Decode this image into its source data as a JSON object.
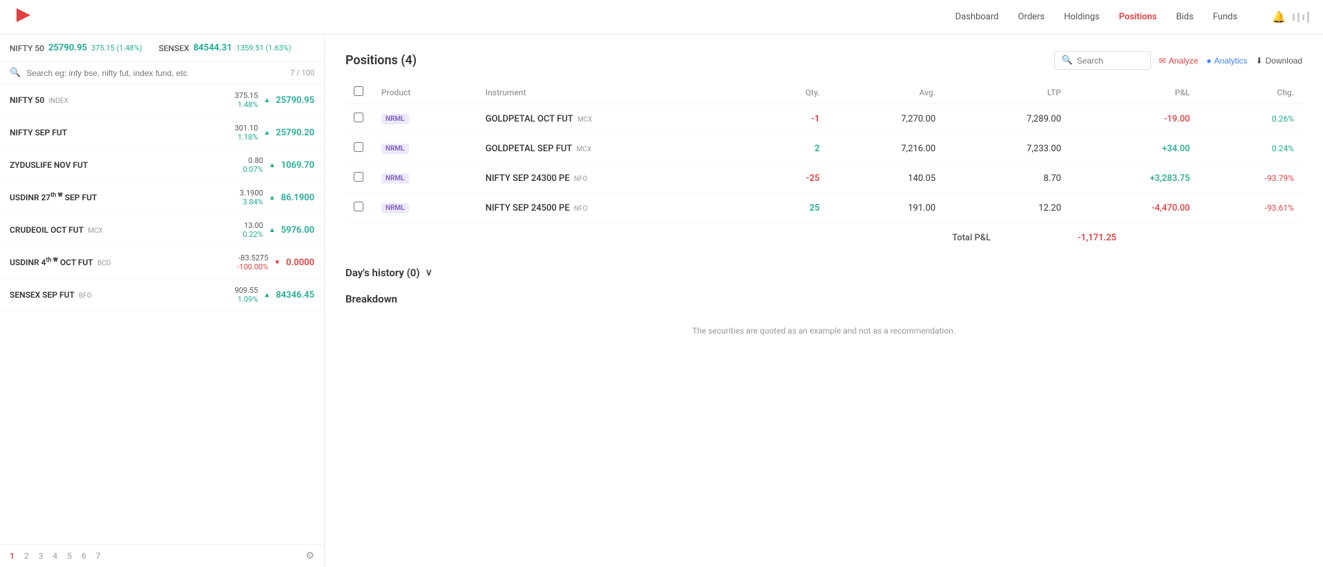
{
  "topnav": {
    "logo": "🔴",
    "links": [
      {
        "label": "Dashboard",
        "active": false
      },
      {
        "label": "Orders",
        "active": false
      },
      {
        "label": "Holdings",
        "active": false
      },
      {
        "label": "Positions",
        "active": true
      },
      {
        "label": "Bids",
        "active": false
      },
      {
        "label": "Funds",
        "active": false
      }
    ]
  },
  "market": [
    {
      "name": "NIFTY 50",
      "value": "25790.95",
      "change": "375.15 (1.48%)",
      "direction": "up"
    },
    {
      "name": "SENSEX",
      "value": "84544.31",
      "change": "1359.51 (1.63%)",
      "direction": "up"
    }
  ],
  "search": {
    "placeholder": "Search eg: infy bse, nifty fut, index fund, etc",
    "count": "7 / 100"
  },
  "watchlist": [
    {
      "name": "NIFTY 50",
      "exchange": "INDEX",
      "change": "375.15",
      "changePct": "1.48%",
      "ltp": "25790.95",
      "direction": "up",
      "sup": ""
    },
    {
      "name": "NIFTY SEP FUT",
      "exchange": "",
      "change": "301.10",
      "changePct": "1.18%",
      "ltp": "25790.20",
      "direction": "up",
      "sup": ""
    },
    {
      "name": "ZYDUSLIFE NOV FUT",
      "exchange": "",
      "change": "0.80",
      "changePct": "0.07%",
      "ltp": "1069.70",
      "direction": "up",
      "sup": ""
    },
    {
      "name": "USDINR 27",
      "exchange": "SEP FUT",
      "change": "3.1900",
      "changePct": "3.84%",
      "ltp": "86.1900",
      "direction": "up",
      "sup": "th ₩"
    },
    {
      "name": "CRUDEOIL OCT FUT",
      "exchange": "MCX",
      "change": "13.00",
      "changePct": "0.22%",
      "ltp": "5976.00",
      "direction": "up",
      "sup": ""
    },
    {
      "name": "USDINR 4",
      "exchange": "OCT FUT",
      "exchange2": "BCD",
      "change": "-83.5275",
      "changePct": "-100.00%",
      "ltp": "0.0000",
      "direction": "down",
      "sup": "th ₩"
    },
    {
      "name": "SENSEX SEP FUT",
      "exchange": "BFO",
      "change": "909.55",
      "changePct": "1.09%",
      "ltp": "84346.45",
      "direction": "up",
      "sup": ""
    }
  ],
  "pagination": {
    "pages": [
      "1",
      "2",
      "3",
      "4",
      "5",
      "6",
      "7"
    ],
    "active": "1"
  },
  "positions": {
    "title": "Positions",
    "count": 4,
    "columns": [
      "Product",
      "Instrument",
      "Qty.",
      "Avg.",
      "LTP",
      "P&L",
      "Chg."
    ],
    "rows": [
      {
        "product": "NRML",
        "instrument": "GOLDPETAL OCT FUT",
        "exchange": "MCX",
        "qty": "-1",
        "avg": "7,270.00",
        "ltp": "7,289.00",
        "pnl": "-19.00",
        "chg": "0.26%",
        "qtyType": "neg",
        "pnlType": "neg"
      },
      {
        "product": "NRML",
        "instrument": "GOLDPETAL SEP FUT",
        "exchange": "MCX",
        "qty": "2",
        "avg": "7,216.00",
        "ltp": "7,233.00",
        "pnl": "+34.00",
        "chg": "0.24%",
        "qtyType": "pos",
        "pnlType": "pos"
      },
      {
        "product": "NRML",
        "instrument": "NIFTY SEP 24300 PE",
        "exchange": "NFO",
        "qty": "-25",
        "avg": "140.05",
        "ltp": "8.70",
        "pnl": "+3,283.75",
        "chg": "-93.79%",
        "qtyType": "neg",
        "pnlType": "pos"
      },
      {
        "product": "NRML",
        "instrument": "NIFTY SEP 24500 PE",
        "exchange": "NFO",
        "qty": "25",
        "avg": "191.00",
        "ltp": "12.20",
        "pnl": "-4,470.00",
        "chg": "-93.61%",
        "qtyType": "pos",
        "pnlType": "neg"
      }
    ],
    "totalLabel": "Total P&L",
    "totalValue": "-1,171.25"
  },
  "actions": {
    "searchPlaceholder": "Search",
    "analyzeLabel": "Analyze",
    "analyticsLabel": "Analytics",
    "downloadLabel": "Download"
  },
  "daysHistory": {
    "title": "Day's history",
    "count": 0
  },
  "breakdown": {
    "title": "Breakdown"
  },
  "disclaimer": "The securities are quoted as an example and not as a recommendation."
}
